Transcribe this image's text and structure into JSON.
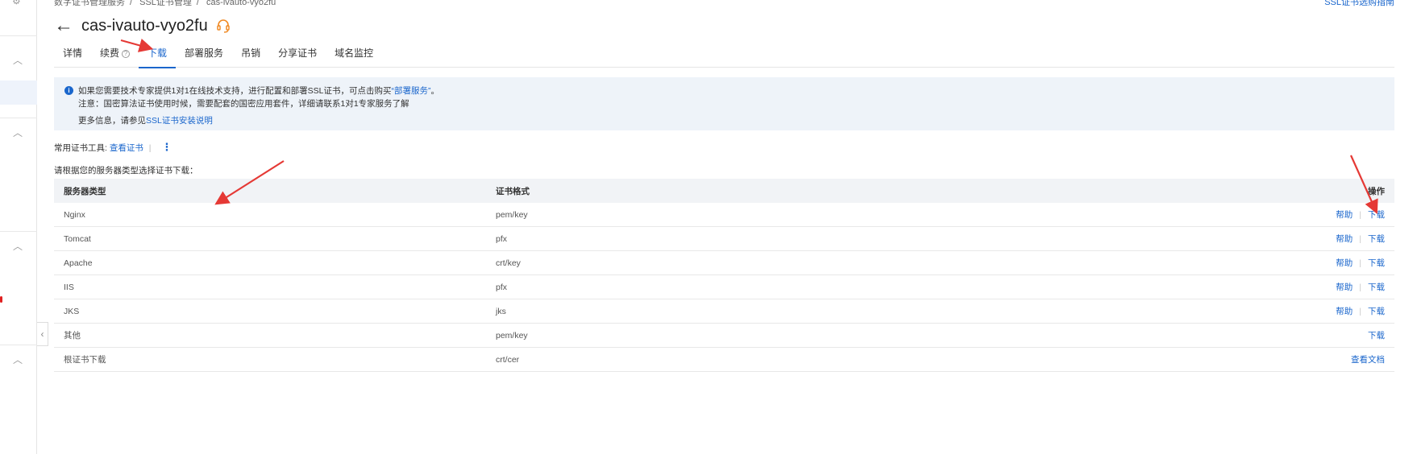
{
  "breadcrumb": [
    "数字证书管理服务",
    "SSL证书管理",
    "cas-ivauto-vyo2fu"
  ],
  "top_right_link": "SSL证书选购指南",
  "header": {
    "title": "cas-ivauto-vyo2fu"
  },
  "tabs": [
    {
      "label": "详情"
    },
    {
      "label": "续费"
    },
    {
      "label": "下载"
    },
    {
      "label": "部署服务"
    },
    {
      "label": "吊销"
    },
    {
      "label": "分享证书"
    },
    {
      "label": "域名监控"
    }
  ],
  "notice": {
    "line1_prefix": "如果您需要技术专家提供1对1在线技术支持，进行配置和部署SSL证书，可点击购买",
    "line1_link": "“部署服务”",
    "line1_suffix": "。",
    "line2": "注意：国密算法证书使用时候，需要配套的国密应用套件，详细请联系1对1专家服务了解",
    "more_prefix": "更多信息，请参见",
    "more_link": "SSL证书安装说明"
  },
  "tools": {
    "label": "常用证书工具:",
    "link": "查看证书"
  },
  "hint": "请根据您的服务器类型选择证书下载：",
  "table": {
    "headers": [
      "服务器类型",
      "证书格式",
      "操作"
    ],
    "rows": [
      {
        "server": "Nginx",
        "format": "pem/key",
        "help": "帮助",
        "action": "下载"
      },
      {
        "server": "Tomcat",
        "format": "pfx",
        "help": "帮助",
        "action": "下载"
      },
      {
        "server": "Apache",
        "format": "crt/key",
        "help": "帮助",
        "action": "下载"
      },
      {
        "server": "IIS",
        "format": "pfx",
        "help": "帮助",
        "action": "下载"
      },
      {
        "server": "JKS",
        "format": "jks",
        "help": "帮助",
        "action": "下载"
      },
      {
        "server": "其他",
        "format": "pem/key",
        "help": "",
        "action": "下载"
      },
      {
        "server": "根证书下载",
        "format": "crt/cer",
        "help": "",
        "action": "查看文档"
      }
    ]
  },
  "colors": {
    "accent": "#1a66cc",
    "annotation": "#e53935",
    "notice_bg": "#eef3f9"
  }
}
